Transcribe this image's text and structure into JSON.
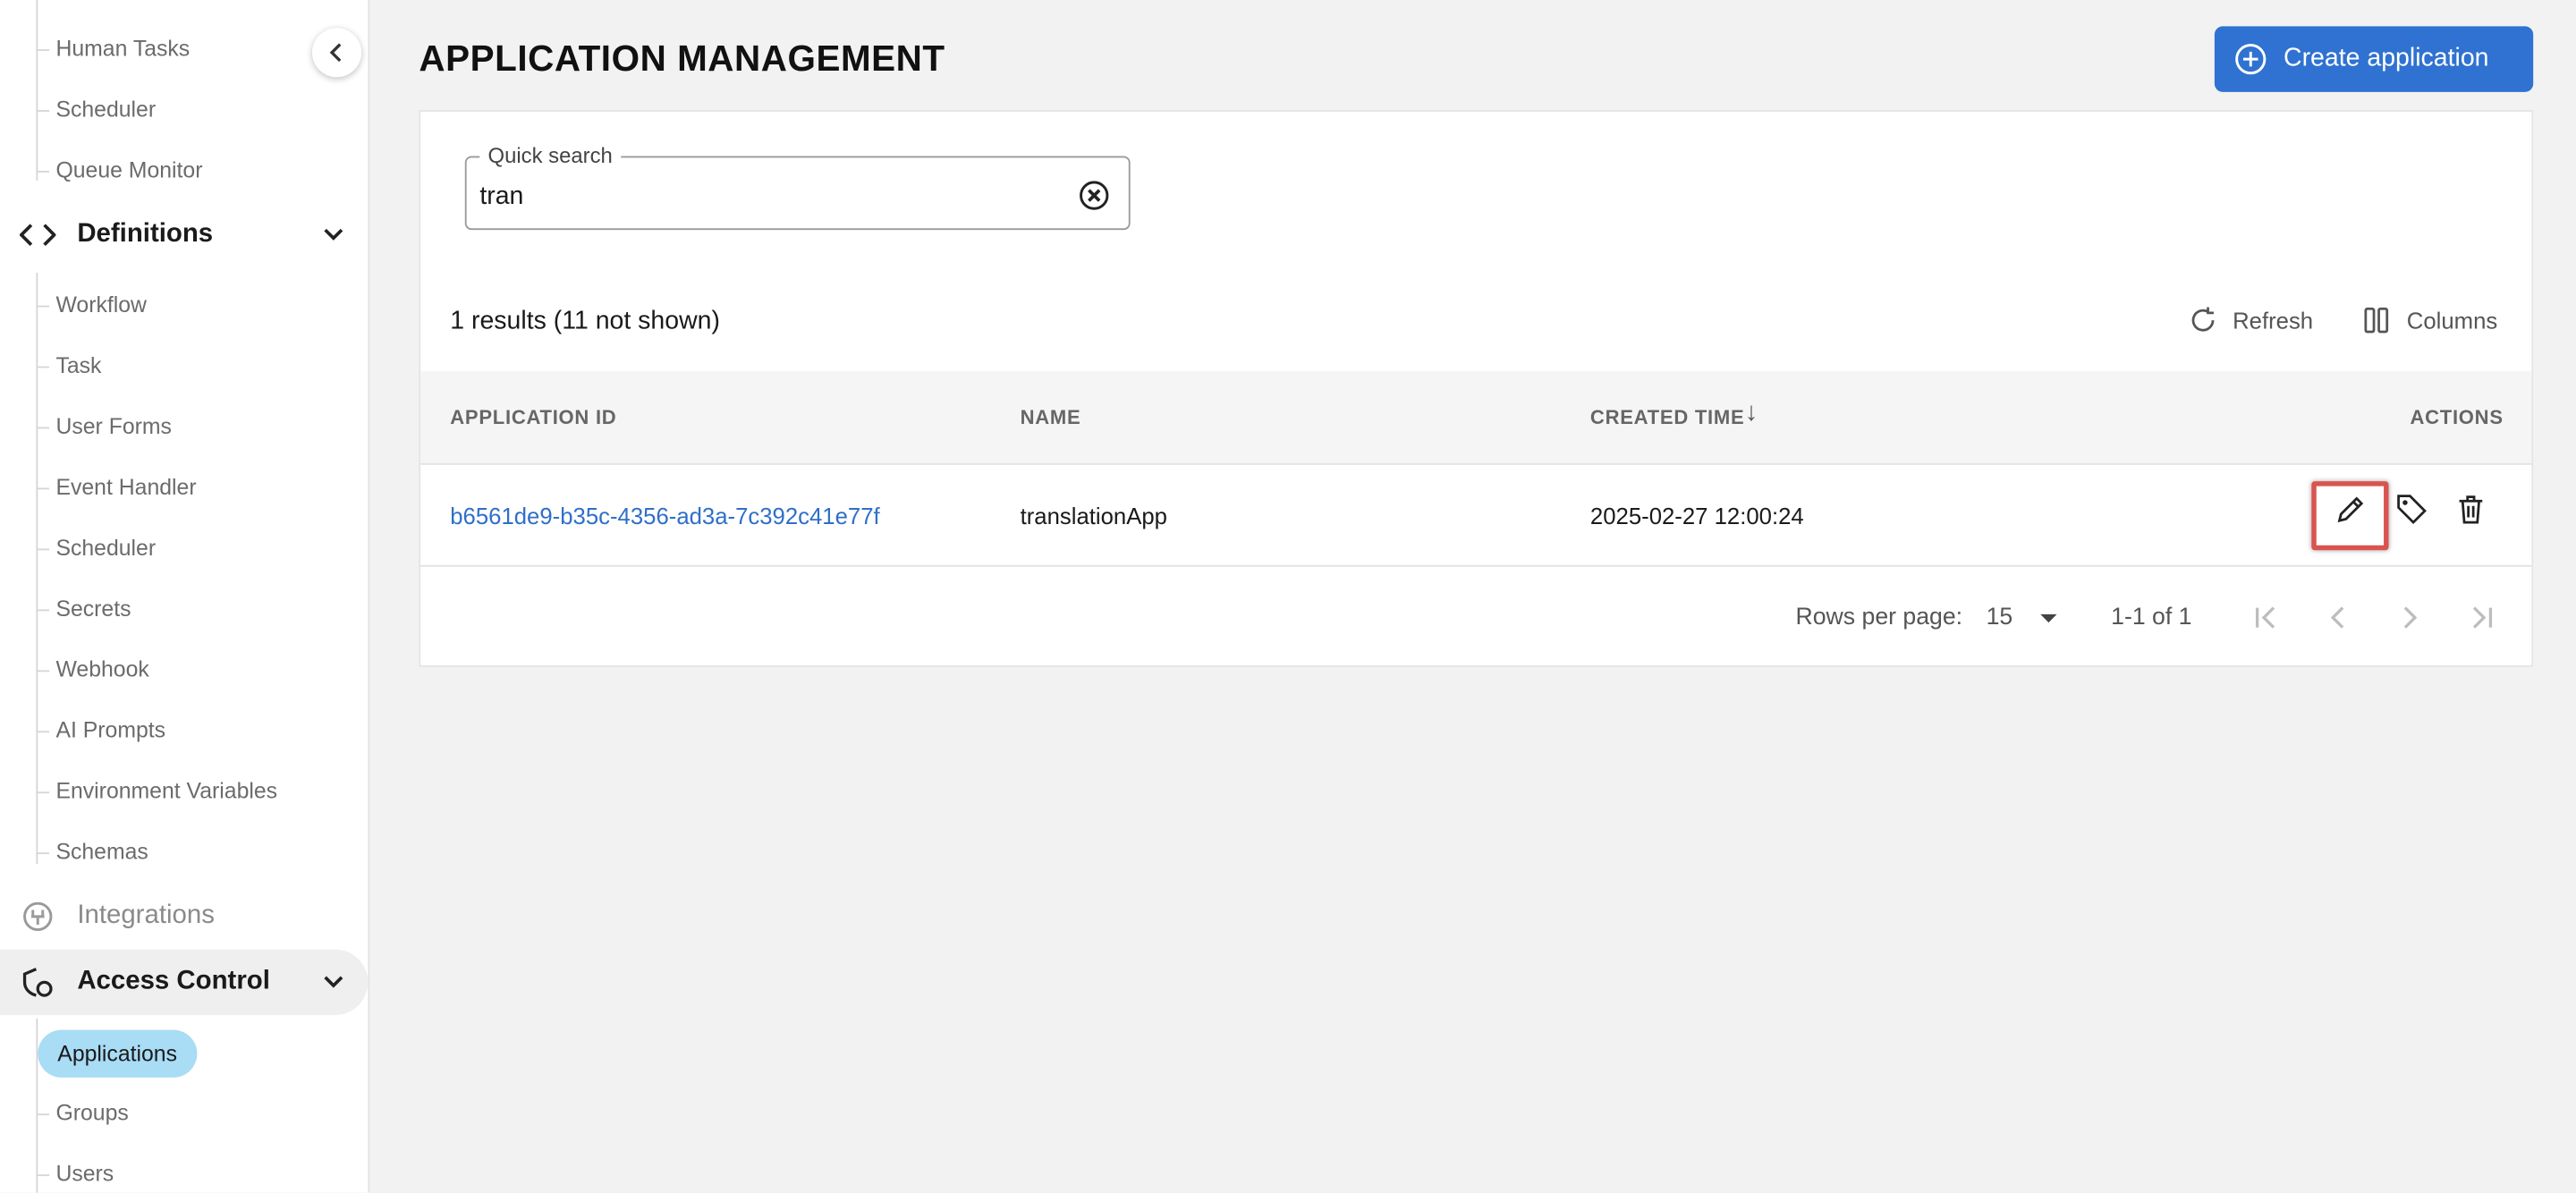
{
  "sidebar": {
    "top_items": [
      "Human Tasks",
      "Scheduler",
      "Queue Monitor"
    ],
    "definitions": {
      "label": "Definitions",
      "items": [
        "Workflow",
        "Task",
        "User Forms",
        "Event Handler",
        "Scheduler",
        "Secrets",
        "Webhook",
        "AI Prompts",
        "Environment Variables",
        "Schemas"
      ]
    },
    "integrations_label": "Integrations",
    "access_control": {
      "label": "Access Control",
      "items": [
        "Applications",
        "Groups",
        "Users"
      ],
      "active": "Applications"
    }
  },
  "header": {
    "title": "APPLICATION MANAGEMENT",
    "create_label": "Create application"
  },
  "search": {
    "legend": "Quick search",
    "value": "tran"
  },
  "results_text": "1 results (11 not shown)",
  "toolbar": {
    "refresh": "Refresh",
    "columns": "Columns"
  },
  "table": {
    "headers": [
      "APPLICATION ID",
      "NAME",
      "CREATED TIME",
      "ACTIONS"
    ],
    "sort_indicator": "↓",
    "rows": [
      {
        "id": "b6561de9-b35c-4356-ad3a-7c392c41e77f",
        "name": "translationApp",
        "created": "2025-02-27 12:00:24"
      }
    ]
  },
  "pagination": {
    "rows_per_page_label": "Rows per page:",
    "rows_per_page": "15",
    "range": "1-1 of 1"
  },
  "colors": {
    "accent": "#2f72d1",
    "active_pill": "#a9dcf5",
    "highlight": "#d9534f",
    "link": "#2f6fc8"
  }
}
